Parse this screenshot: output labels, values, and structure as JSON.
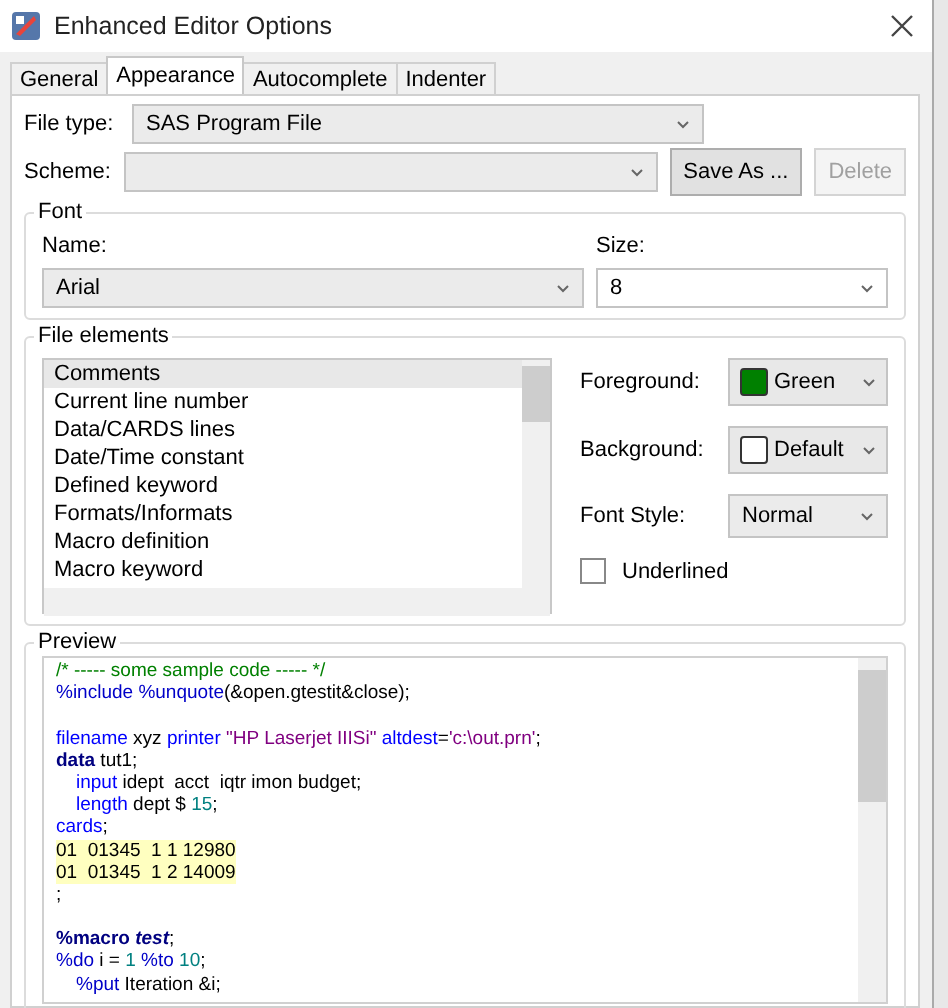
{
  "window": {
    "title": "Enhanced Editor Options"
  },
  "tabs": [
    {
      "label": "General",
      "selected": false
    },
    {
      "label": "Appearance",
      "selected": true
    },
    {
      "label": "Autocomplete",
      "selected": false
    },
    {
      "label": "Indenter",
      "selected": false
    }
  ],
  "file_type": {
    "label": "File type:",
    "value": "SAS Program File"
  },
  "scheme": {
    "label": "Scheme:",
    "buttons": [
      {
        "label": "Save As ...",
        "disabled": false
      },
      {
        "label": "Delete",
        "disabled": true
      }
    ]
  },
  "font": {
    "title": "Font",
    "name_label": "Name:",
    "name_value": "Arial",
    "size_label": "Size:",
    "size_value": "8"
  },
  "file_elements": {
    "title": "File elements",
    "items": [
      {
        "label": "Comments",
        "selected": true
      },
      {
        "label": "Current line number",
        "selected": false
      },
      {
        "label": "Data/CARDS lines",
        "selected": false
      },
      {
        "label": "Date/Time constant",
        "selected": false
      },
      {
        "label": "Defined keyword",
        "selected": false
      },
      {
        "label": "Formats/Informats",
        "selected": false
      },
      {
        "label": "Macro definition",
        "selected": false
      },
      {
        "label": "Macro keyword",
        "selected": false
      }
    ],
    "foreground": {
      "label": "Foreground:",
      "value": "Green",
      "color": "#008000"
    },
    "background": {
      "label": "Background:",
      "value": "Default",
      "color": "#ffffff"
    },
    "font_style": {
      "label": "Font Style:",
      "value": "Normal"
    },
    "underlined": {
      "label": "Underlined",
      "checked": false
    }
  },
  "preview": {
    "title": "Preview",
    "lines": [
      {
        "kind": "code",
        "tokens": [
          {
            "kind": "comment",
            "text": "/* ----- some sample code ----- */"
          }
        ]
      },
      {
        "kind": "code",
        "tokens": [
          {
            "kind": "macro",
            "text": "%include "
          },
          {
            "kind": "macro",
            "text": "%unquote"
          },
          {
            "kind": "plain",
            "text": "(&open.gtestit&close);"
          }
        ]
      },
      {
        "kind": "blank"
      },
      {
        "kind": "code",
        "tokens": [
          {
            "kind": "keyword",
            "text": "filename"
          },
          {
            "kind": "plain",
            "text": " xyz "
          },
          {
            "kind": "keyword",
            "text": "printer "
          },
          {
            "kind": "string",
            "text": "\"HP Laserjet IIISi\" "
          },
          {
            "kind": "keyword",
            "text": "altdest"
          },
          {
            "kind": "plain",
            "text": "="
          },
          {
            "kind": "string",
            "text": "'c:\\out.prn'"
          },
          {
            "kind": "plain",
            "text": ";"
          }
        ]
      },
      {
        "kind": "code",
        "tokens": [
          {
            "kind": "step",
            "text": "data"
          },
          {
            "kind": "plain",
            "text": " tut1;"
          }
        ],
        "children": [
          {
            "kind": "code",
            "tokens": [
              {
                "kind": "keyword",
                "text": "input"
              },
              {
                "kind": "plain",
                "text": " idept  acct  iqtr imon budget;"
              }
            ]
          },
          {
            "kind": "code",
            "tokens": [
              {
                "kind": "keyword",
                "text": "length"
              },
              {
                "kind": "plain",
                "text": " dept $ "
              },
              {
                "kind": "number",
                "text": "15"
              },
              {
                "kind": "plain",
                "text": ";"
              }
            ]
          }
        ]
      },
      {
        "kind": "code",
        "tokens": [
          {
            "kind": "keyword",
            "text": "cards"
          },
          {
            "kind": "plain",
            "text": ";"
          }
        ]
      },
      {
        "kind": "data",
        "text": "01  01345  1 1 12980"
      },
      {
        "kind": "data",
        "text": "01  01345  1 2 14009"
      },
      {
        "kind": "code",
        "tokens": [
          {
            "kind": "plain",
            "text": ";"
          }
        ]
      },
      {
        "kind": "blank"
      },
      {
        "kind": "code",
        "tokens": [
          {
            "kind": "macrodef",
            "text": "%macro "
          },
          {
            "kind": "macroname",
            "text": "test"
          },
          {
            "kind": "plain",
            "text": ";"
          }
        ]
      },
      {
        "kind": "code",
        "tokens": [
          {
            "kind": "macro",
            "text": "%do"
          },
          {
            "kind": "plain",
            "text": " i = "
          },
          {
            "kind": "number",
            "text": "1 "
          },
          {
            "kind": "macro",
            "text": "%to "
          },
          {
            "kind": "number",
            "text": "10"
          },
          {
            "kind": "plain",
            "text": ";"
          }
        ],
        "children": [
          {
            "kind": "code",
            "tokens": [
              {
                "kind": "macro",
                "text": "%put"
              },
              {
                "kind": "plain",
                "text": " Iteration &i;"
              }
            ]
          }
        ]
      }
    ]
  }
}
